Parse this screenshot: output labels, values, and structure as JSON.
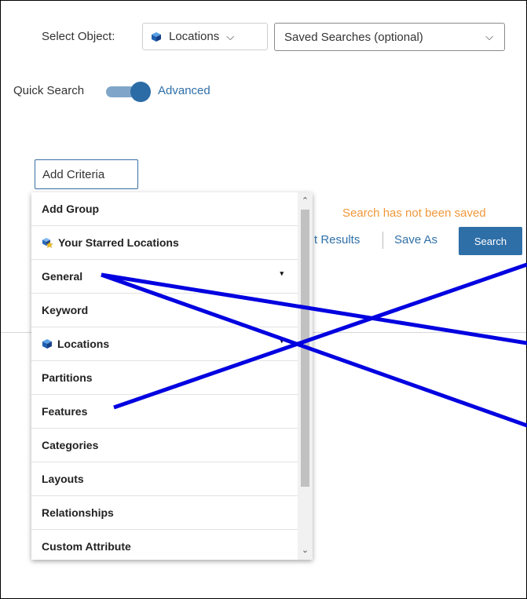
{
  "toolbar": {
    "select_object_label": "Select Object:",
    "object_value": "Locations",
    "object_chevron": "⌵",
    "saved_searches_placeholder": "Saved Searches (optional)",
    "saved_chevron": "⌵"
  },
  "mode_toggle": {
    "left_label": "Quick Search",
    "right_label": "Advanced",
    "active": "Advanced"
  },
  "criteria": {
    "add_label": "Add Criteria"
  },
  "status": {
    "not_saved": "Search has not been saved"
  },
  "actions": {
    "results_label": "t Results",
    "save_as_label": "Save As",
    "search_label": "Search"
  },
  "dropdown": {
    "items": [
      {
        "label": "Add Group",
        "icon": ""
      },
      {
        "label": "Your Starred Locations",
        "icon": "starred-cube-icon"
      },
      {
        "label": "General",
        "icon": "",
        "caret": "▾"
      },
      {
        "label": "Keyword",
        "icon": ""
      },
      {
        "label": "Locations",
        "icon": "cube-icon",
        "caret": "▾"
      },
      {
        "label": "Partitions",
        "icon": ""
      },
      {
        "label": "Features",
        "icon": ""
      },
      {
        "label": "Categories",
        "icon": ""
      },
      {
        "label": "Layouts",
        "icon": ""
      },
      {
        "label": "Relationships",
        "icon": ""
      },
      {
        "label": "Custom Attribute",
        "icon": ""
      }
    ],
    "scroll_up": "⌃",
    "scroll_down": "⌄"
  },
  "colors": {
    "accent": "#2f6fa8",
    "warning": "#f0983a",
    "annotation": "#0000e0"
  }
}
